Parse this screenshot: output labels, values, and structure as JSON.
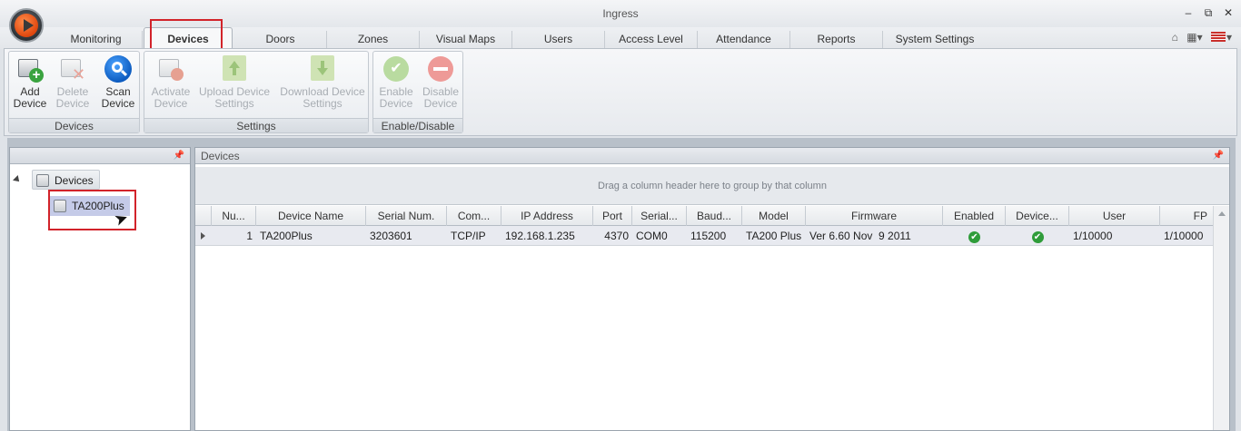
{
  "window": {
    "title": "Ingress",
    "minimize": "–",
    "restore": "⧉",
    "close": "✕"
  },
  "tabs": [
    {
      "label": "Monitoring"
    },
    {
      "label": "Devices"
    },
    {
      "label": "Doors"
    },
    {
      "label": "Zones"
    },
    {
      "label": "Visual Maps"
    },
    {
      "label": "Users"
    },
    {
      "label": "Access Level"
    },
    {
      "label": "Attendance"
    },
    {
      "label": "Reports"
    },
    {
      "label": "System Settings"
    }
  ],
  "ribbon": {
    "groups": [
      {
        "label": "Devices",
        "buttons": [
          {
            "line1": "Add",
            "line2": "Device",
            "icon": "add-device-icon"
          },
          {
            "line1": "Delete",
            "line2": "Device",
            "icon": "delete-device-icon"
          },
          {
            "line1": "Scan",
            "line2": "Device",
            "icon": "scan-device-icon"
          }
        ]
      },
      {
        "label": "Settings",
        "buttons": [
          {
            "line1": "Activate",
            "line2": "Device",
            "icon": "activate-device-icon"
          },
          {
            "line1": "Upload Device",
            "line2": "Settings",
            "icon": "upload-settings-icon"
          },
          {
            "line1": "Download Device",
            "line2": "Settings",
            "icon": "download-settings-icon"
          }
        ]
      },
      {
        "label": "Enable/Disable",
        "buttons": [
          {
            "line1": "Enable",
            "line2": "Device",
            "icon": "enable-device-icon"
          },
          {
            "line1": "Disable",
            "line2": "Device",
            "icon": "disable-device-icon"
          }
        ]
      }
    ]
  },
  "left_panel": {
    "tree_root": "Devices",
    "tree_children": [
      "TA200Plus"
    ]
  },
  "right_panel": {
    "title": "Devices",
    "group_hint": "Drag a column header here to group by that column",
    "columns": [
      "Nu...",
      "Device Name",
      "Serial Num.",
      "Com...",
      "IP Address",
      "Port",
      "Serial...",
      "Baud...",
      "Model",
      "Firmware",
      "Enabled",
      "Device...",
      "User",
      "FP"
    ],
    "rows": [
      {
        "num": "1",
        "device_name": "TA200Plus",
        "serial_num": "3203601",
        "com": "TCP/IP",
        "ip": "192.168.1.235",
        "port": "4370",
        "serial": "COM0",
        "baud": "115200",
        "model": "TA200 Plus",
        "firmware": "Ver 6.60 Nov  9 2011",
        "enabled": "✔",
        "device_status": "✔",
        "user": "1/10000",
        "fp": "1/10000"
      }
    ]
  },
  "colors": {
    "highlight": "#d2232a",
    "check_green": "#2f9c3a",
    "selected_node": "#c5cbe8"
  }
}
